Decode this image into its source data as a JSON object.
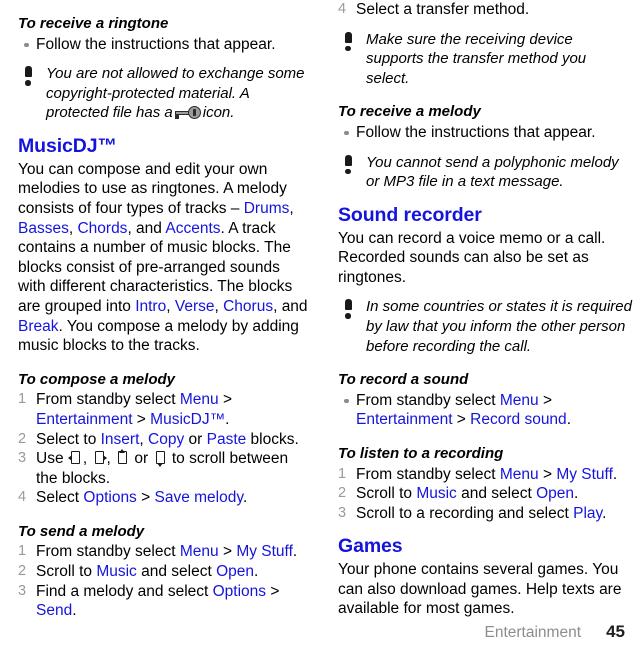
{
  "footer": {
    "chapter": "Entertainment",
    "page_number": "45"
  },
  "left_column": {
    "proc_receive_ringtone": {
      "title": "To receive a ringtone",
      "bullets": [
        "Follow the instructions that appear."
      ]
    },
    "note_copyright": {
      "icon": "exclamation-icon",
      "text_before": "You are not allowed to exchange some copyright-protected material. A protected file has a",
      "inline_icon": "key-icon",
      "text_after": "icon."
    },
    "section_musicdj": {
      "heading": "MusicDJ™",
      "para_1_a": "You can compose and edit your own melodies to use as ringtones. A melody consists of four types of tracks – ",
      "track_1": "Drums",
      "track_2": "Basses",
      "track_3": "Chords",
      "track_4": "Accents",
      "para_1_b": ", and ",
      "para_1_c": ". A track contains a number of music blocks. The blocks consist of pre-arranged sounds with different characteristics. The blocks are grouped into ",
      "group_1": "Intro",
      "group_2": "Verse",
      "group_3": "Chorus",
      "group_4": "Break",
      "para_1_d": ", and ",
      "para_1_e": ". You compose a melody by adding music blocks to the tracks."
    },
    "proc_compose_melody": {
      "title": "To compose a melody",
      "steps": [
        {
          "num": "1",
          "t1": "From standby select ",
          "l1": "Menu",
          "t2": " > ",
          "l2": "Entertainment",
          "t3": " > ",
          "l3": "MusicDJ™",
          "t4": "."
        },
        {
          "num": "2",
          "t1": "Select to ",
          "l1": "Insert",
          "t2": ", ",
          "l2": "Copy",
          "t3": " or ",
          "l3": "Paste",
          "t4": " blocks."
        },
        {
          "num": "3",
          "t1": "Use ",
          "icons": [
            "nav-left-key-icon",
            "nav-right-key-icon",
            "nav-up-key-icon",
            "nav-down-key-icon"
          ],
          "t2": ", ",
          "t3": ", ",
          "t4": " or ",
          "t5": " to scroll between the blocks."
        },
        {
          "num": "4",
          "t1": "Select ",
          "l1": "Options",
          "t2": " > ",
          "l2": "Save melody",
          "t3": "."
        }
      ]
    },
    "proc_send_melody": {
      "title": "To send a melody",
      "steps": [
        {
          "num": "1",
          "t1": "From standby select ",
          "l1": "Menu",
          "t2": " > ",
          "l2": "My Stuff",
          "t3": "."
        },
        {
          "num": "2",
          "t1": "Scroll to ",
          "l1": "Music",
          "t2": " and select ",
          "l2": "Open",
          "t3": "."
        },
        {
          "num": "3",
          "t1": "Find a melody and select ",
          "l1": "Options",
          "t2": " > ",
          "l2": "Send",
          "t3": "."
        }
      ]
    }
  },
  "right_column": {
    "step_continued": {
      "num": "4",
      "text": "Select a transfer method."
    },
    "note_transfer": {
      "icon": "exclamation-icon",
      "text": "Make sure the receiving device supports the transfer method you select."
    },
    "proc_receive_melody": {
      "title": "To receive a melody",
      "bullets": [
        "Follow the instructions that appear."
      ]
    },
    "note_polyphonic": {
      "icon": "exclamation-icon",
      "text": "You cannot send a polyphonic melody or MP3 file in a text message."
    },
    "section_sound_recorder": {
      "heading": "Sound recorder",
      "para": "You can record a voice memo or a call. Recorded sounds can also be set as ringtones."
    },
    "note_recording_law": {
      "icon": "exclamation-icon",
      "text": "In some countries or states it is required by law that you inform the other person before recording the call."
    },
    "proc_record_sound": {
      "title": "To record a sound",
      "bullet": {
        "t1": "From standby select ",
        "l1": "Menu",
        "t2": " > ",
        "l2": "Entertainment",
        "t3": " > ",
        "l3": "Record sound",
        "t4": "."
      }
    },
    "proc_listen_recording": {
      "title": "To listen to a recording",
      "steps": [
        {
          "num": "1",
          "t1": "From standby select ",
          "l1": "Menu",
          "t2": " > ",
          "l2": "My Stuff",
          "t3": "."
        },
        {
          "num": "2",
          "t1": "Scroll to ",
          "l1": "Music",
          "t2": " and select ",
          "l2": "Open",
          "t3": "."
        },
        {
          "num": "3",
          "t1": "Scroll to a recording and select ",
          "l1": "Play",
          "t2": "."
        }
      ]
    },
    "section_games": {
      "heading": "Games",
      "para": "Your phone contains several games. You can also download games. Help texts are available for most games."
    }
  },
  "colors": {
    "link_blue": "#1414dc",
    "heading_blue": "#1414dc",
    "step_number_gray": "#9a9a9a",
    "bullet_gray": "#8c8c8c",
    "footer_chapter_gray": "#8d8d8d"
  }
}
